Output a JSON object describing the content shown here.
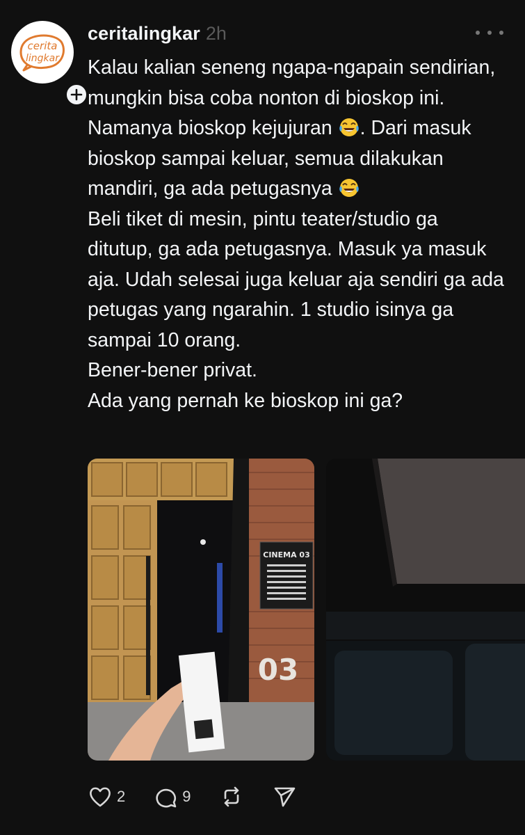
{
  "post": {
    "avatar": {
      "logo_line1": "cerita",
      "logo_line2": "lingkar",
      "brand_color": "#e07a2e"
    },
    "username": "ceritalingkar",
    "timestamp": "2h",
    "text": {
      "line1_a": "Kalau kalian seneng ngapa-ngapain sendirian, mungkin bisa coba nonton di bioskop ini. Namanya bioskop kejujuran ",
      "line1_emoji": "face-with-tears-of-joy-emoji",
      "line1_b": ". Dari masuk bioskop sampai keluar, semua dilakukan mandiri, ga ada petugasnya ",
      "line1_emoji2": "face-with-tears-of-joy-emoji",
      "para2": "Beli tiket di mesin, pintu teater/studio ga ditutup, ga ada petugasnya. Masuk ya masuk aja. Udah selesai juga keluar aja sendiri ga ada petugas yang ngarahin. 1 studio isinya ga sampai 10 orang.",
      "para3": "Bener-bener privat.",
      "para4": "Ada yang pernah ke bioskop ini ga?"
    },
    "media": {
      "image1": {
        "sign_title": "CINEMA 03",
        "wall_number": "03"
      }
    },
    "actions": {
      "likes": "2",
      "replies": "9"
    }
  },
  "colors": {
    "background": "#101010",
    "text": "#f3f5f7",
    "muted": "#5a5a5a",
    "icon": "#d8d8d8"
  }
}
